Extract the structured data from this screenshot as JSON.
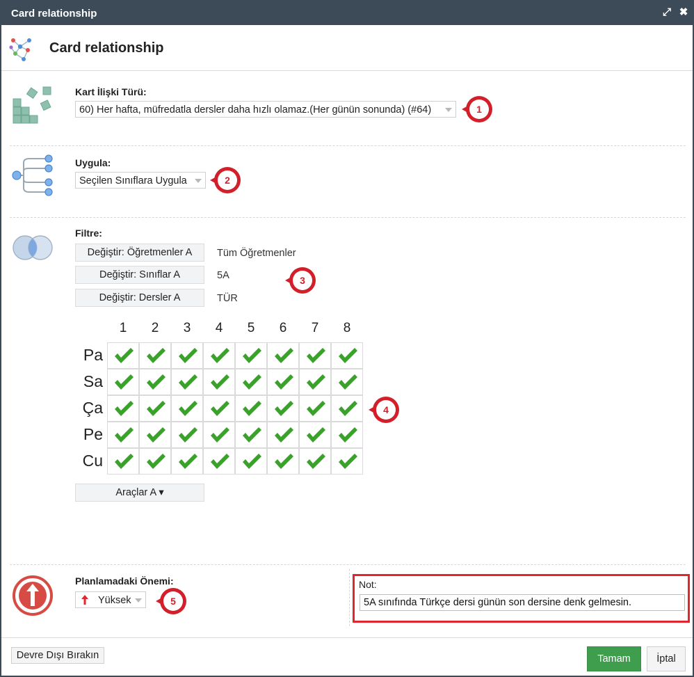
{
  "window": {
    "title": "Card relationship",
    "maximize_glyph": "⤢",
    "close_glyph": "✖"
  },
  "header": {
    "title": "Card relationship",
    "icon": "network-graph-icon"
  },
  "relation_type": {
    "label": "Kart İlişki Türü:",
    "value": "60) Her hafta, müfredatla dersler daha hızlı olamaz.(Her günün sonunda) (#64)",
    "icon": "cards-cluster-icon",
    "badge": "1"
  },
  "apply": {
    "label": "Uygula:",
    "value": "Seçilen Sınıflara Uygula",
    "icon": "branch-tree-icon",
    "badge": "2"
  },
  "filter": {
    "label": "Filtre:",
    "icon": "venn-circles-icon",
    "badge": "3",
    "rows": [
      {
        "button": "Değiştir: Öğretmenler A",
        "value": "Tüm Öğretmenler"
      },
      {
        "button": "Değiştir: Sınıflar A",
        "value": "5A"
      },
      {
        "button": "Değiştir: Dersler A",
        "value": "TÜR"
      }
    ]
  },
  "grid": {
    "badge": "4",
    "columns": [
      "1",
      "2",
      "3",
      "4",
      "5",
      "6",
      "7",
      "8"
    ],
    "rows": [
      "Pa",
      "Sa",
      "Ça",
      "Pe",
      "Cu"
    ],
    "cell_state": "allowed",
    "check_color": "#3aa12a",
    "tools_button": "Araçlar A ▾"
  },
  "importance": {
    "label": "Planlamadaki Önemi:",
    "value": "Yüksek",
    "icon": "arrow-up-circle-icon",
    "badge": "5",
    "arrow_color": "#e3262d"
  },
  "note": {
    "label": "Not:",
    "value": "5A sınıfında Türkçe dersi günün son dersine denk gelmesin."
  },
  "footer": {
    "disable_button": "Devre Dışı Bırakın",
    "ok_button": "Tamam",
    "cancel_button": "İptal",
    "ok_color": "#3f9e4d"
  }
}
